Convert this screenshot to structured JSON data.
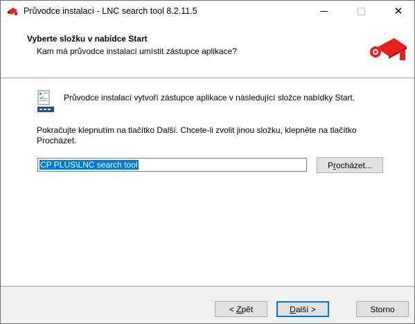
{
  "window": {
    "title": "Průvodce instalací - LNC search tool 8.2.11.5",
    "title_icon": "camera-logo-icon",
    "controls": {
      "minimize": "minimize-icon",
      "maximize": "maximize-icon",
      "close": "✕"
    }
  },
  "header": {
    "title": "Vyberte složku v nabídce Start",
    "subtitle": "Kam má průvodce instalací umístit zástupce aplikace?",
    "logo_icon": "security-camera-icon"
  },
  "body": {
    "intro": "Průvodce instalací vytvoří zástupce aplikace v následující složce nabídky Start.",
    "continue_text": "Pokračujte klepnutím na tlačítko Další. Chcete-li zvolit jinou složku, klepněte na tlačítko Procházet.",
    "folder_input_value": "CP PLUS\\LNC search tool",
    "browse_prefix": "P",
    "browse_underlined": "r",
    "browse_suffix": "ocházet..."
  },
  "footer": {
    "back_prefix": "< ",
    "back_underlined": "Z",
    "back_suffix": "pět",
    "next_underlined": "D",
    "next_suffix": "alší >",
    "cancel": "Storno"
  },
  "colors": {
    "brand_red": "#e8201d",
    "selection": "#0078d7",
    "default_button_border": "#0078d7"
  }
}
